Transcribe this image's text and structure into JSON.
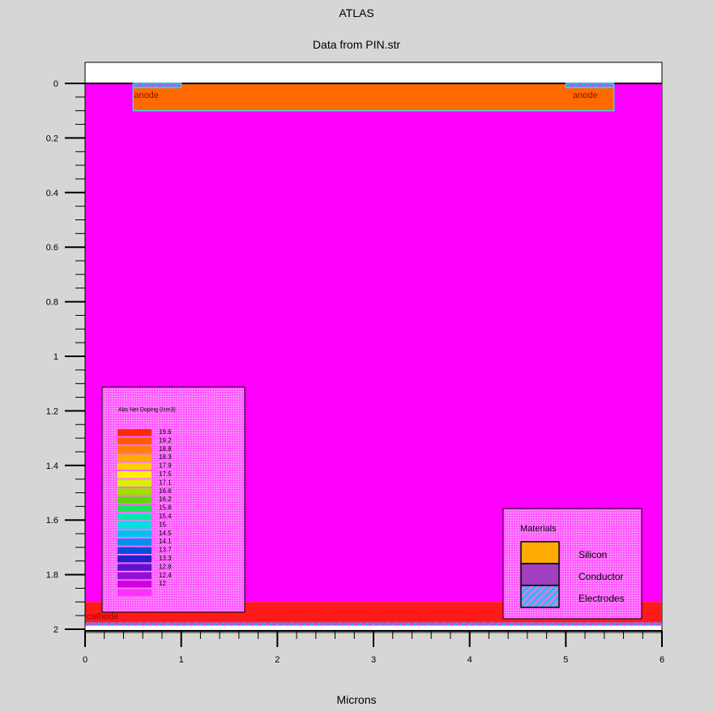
{
  "chart_data": {
    "type": "heatmap",
    "title": "ATLAS",
    "subtitle": "Data from PIN.str",
    "xlabel": "Microns",
    "ylabel": "",
    "xlim": [
      0,
      6
    ],
    "ylim": [
      2,
      0
    ],
    "x_ticks": [
      "0",
      "1",
      "2",
      "3",
      "4",
      "5",
      "6"
    ],
    "y_ticks": [
      "0",
      "0.2",
      "0.4",
      "0.6",
      "0.8",
      "1",
      "1.2",
      "1.4",
      "1.6",
      "1.8",
      "2"
    ],
    "grid": false,
    "regions": [
      {
        "name": "substrate",
        "x": [
          0,
          6
        ],
        "y": [
          0,
          1.9
        ],
        "color": "#ff00ff"
      },
      {
        "name": "anode-diffusion",
        "x": [
          0.5,
          5.5
        ],
        "y": [
          0,
          0.1
        ],
        "color": "#ff6a00"
      },
      {
        "name": "cathode-diffusion",
        "x": [
          0,
          6
        ],
        "y": [
          1.9,
          1.975
        ],
        "color": "#ff1a1a"
      }
    ],
    "electrodes": [
      {
        "label": "anode",
        "x": [
          0.5,
          1.0
        ]
      },
      {
        "label": "anode",
        "x": [
          5.0,
          5.5
        ]
      },
      {
        "label": "cathode",
        "x": [
          0,
          6
        ]
      }
    ],
    "colorbar": {
      "title": "Abs Net Doping (/cm3)",
      "values": [
        "19.6",
        "19.2",
        "18.8",
        "18.3",
        "17.9",
        "17.5",
        "17.1",
        "16.6",
        "16.2",
        "15.8",
        "15.4",
        "15",
        "14.5",
        "14.1",
        "13.7",
        "13.3",
        "12.8",
        "12.4",
        "12"
      ],
      "colors": [
        "#ff2a00",
        "#ff5a00",
        "#ff8000",
        "#ffaa00",
        "#ffd000",
        "#fff000",
        "#d8f000",
        "#a0e000",
        "#60d800",
        "#20e060",
        "#00e8b0",
        "#00e0e0",
        "#00c0f0",
        "#0090f0",
        "#0050e0",
        "#2020d0",
        "#6010d0",
        "#9010d8",
        "#d000e0",
        "#ff30ff"
      ]
    },
    "materials_legend": {
      "title": "Materials",
      "items": [
        {
          "label": "Silicon",
          "color": "#ffaa00"
        },
        {
          "label": "Conductor",
          "color": "#a040c0"
        },
        {
          "label": "Electrodes",
          "color": "#c080ff",
          "hatch": "#00d0d0"
        }
      ]
    }
  }
}
